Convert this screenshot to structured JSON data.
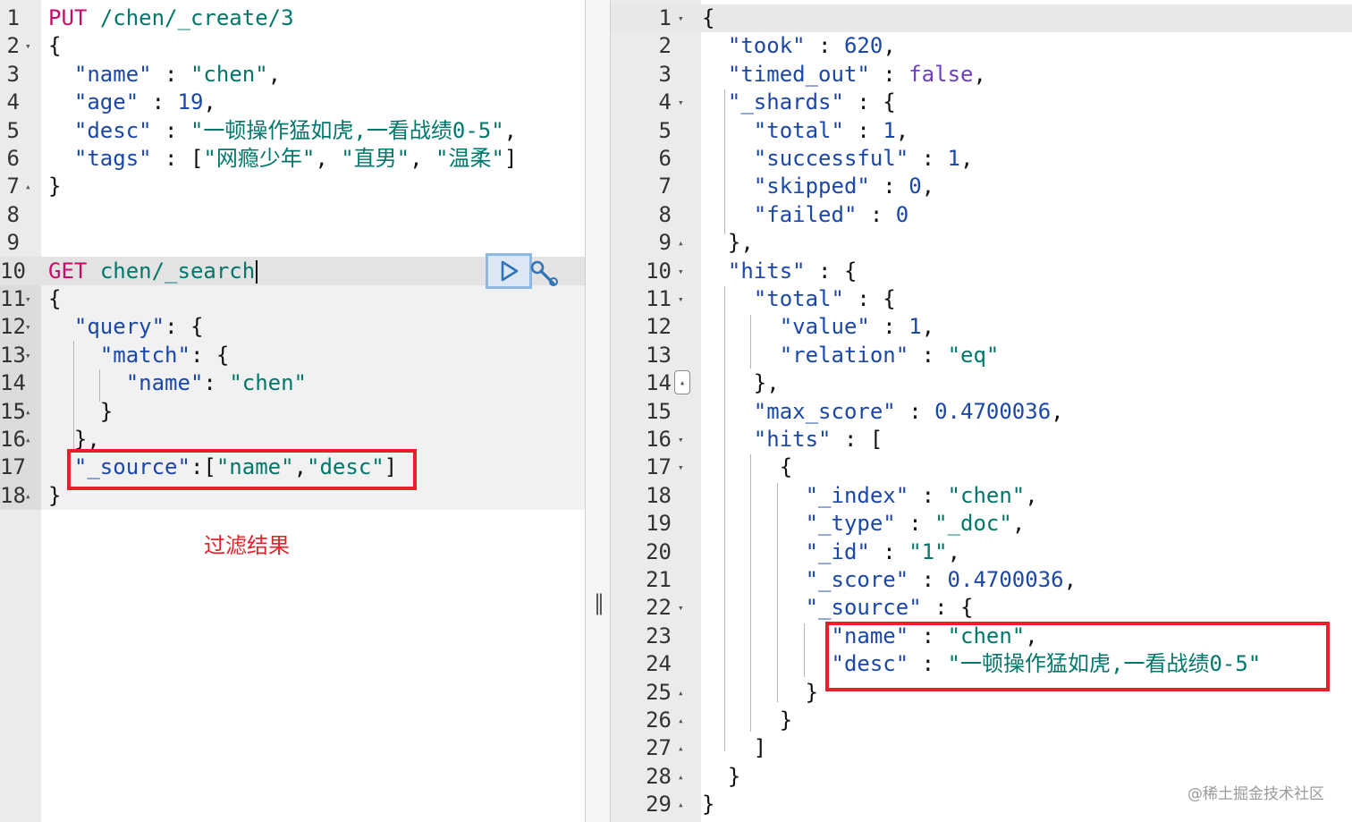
{
  "left_editor": {
    "lines": [
      {
        "ln": "1",
        "fold": "",
        "parts": [
          [
            "method",
            "PUT"
          ],
          [
            "p",
            " "
          ],
          [
            "url",
            "/chen/_create/3"
          ]
        ]
      },
      {
        "ln": "2",
        "fold": "▾",
        "parts": [
          [
            "p",
            "{"
          ]
        ]
      },
      {
        "ln": "3",
        "fold": "",
        "parts": [
          [
            "p",
            "  "
          ],
          [
            "key",
            "\"name\""
          ],
          [
            "p",
            " : "
          ],
          [
            "str",
            "\"chen\""
          ],
          [
            "p",
            ","
          ]
        ]
      },
      {
        "ln": "4",
        "fold": "",
        "parts": [
          [
            "p",
            "  "
          ],
          [
            "key",
            "\"age\""
          ],
          [
            "p",
            " : "
          ],
          [
            "num",
            "19"
          ],
          [
            "p",
            ","
          ]
        ]
      },
      {
        "ln": "5",
        "fold": "",
        "parts": [
          [
            "p",
            "  "
          ],
          [
            "key",
            "\"desc\""
          ],
          [
            "p",
            " : "
          ],
          [
            "str",
            "\"一顿操作猛如虎,一看战绩0-5\""
          ],
          [
            "p",
            ","
          ]
        ]
      },
      {
        "ln": "6",
        "fold": "",
        "parts": [
          [
            "p",
            "  "
          ],
          [
            "key",
            "\"tags\""
          ],
          [
            "p",
            " : ["
          ],
          [
            "str",
            "\"网瘾少年\""
          ],
          [
            "p",
            ", "
          ],
          [
            "str",
            "\"直男\""
          ],
          [
            "p",
            ", "
          ],
          [
            "str",
            "\"温柔\""
          ],
          [
            "p",
            "]"
          ]
        ]
      },
      {
        "ln": "7",
        "fold": "▴",
        "parts": [
          [
            "p",
            "}"
          ]
        ]
      },
      {
        "ln": "8",
        "fold": "",
        "parts": []
      },
      {
        "ln": "9",
        "fold": "",
        "parts": []
      },
      {
        "ln": "10",
        "fold": "",
        "parts": [
          [
            "method",
            "GET"
          ],
          [
            "p",
            " "
          ],
          [
            "url",
            "chen/_search"
          ]
        ]
      },
      {
        "ln": "11",
        "fold": "▾",
        "parts": [
          [
            "p",
            "{"
          ]
        ]
      },
      {
        "ln": "12",
        "fold": "▾",
        "parts": [
          [
            "p",
            "  "
          ],
          [
            "key",
            "\"query\""
          ],
          [
            "p",
            ": {"
          ]
        ]
      },
      {
        "ln": "13",
        "fold": "▾",
        "parts": [
          [
            "p",
            "    "
          ],
          [
            "key",
            "\"match\""
          ],
          [
            "p",
            ": {"
          ]
        ]
      },
      {
        "ln": "14",
        "fold": "",
        "parts": [
          [
            "p",
            "      "
          ],
          [
            "key",
            "\"name\""
          ],
          [
            "p",
            ": "
          ],
          [
            "str",
            "\"chen\""
          ]
        ]
      },
      {
        "ln": "15",
        "fold": "▴",
        "parts": [
          [
            "p",
            "    }"
          ]
        ]
      },
      {
        "ln": "16",
        "fold": "▴",
        "parts": [
          [
            "p",
            "  },"
          ]
        ]
      },
      {
        "ln": "17",
        "fold": "",
        "parts": [
          [
            "p",
            "  "
          ],
          [
            "key",
            "\"_source\""
          ],
          [
            "p",
            ":["
          ],
          [
            "str",
            "\"name\""
          ],
          [
            "p",
            ","
          ],
          [
            "str",
            "\"desc\""
          ],
          [
            "p",
            "]"
          ]
        ]
      },
      {
        "ln": "18",
        "fold": "▴",
        "parts": [
          [
            "p",
            "}"
          ]
        ]
      }
    ]
  },
  "right_editor": {
    "lines": [
      {
        "ln": "1",
        "fold": "▾",
        "parts": [
          [
            "p",
            "{"
          ]
        ]
      },
      {
        "ln": "2",
        "fold": "",
        "parts": [
          [
            "p",
            "  "
          ],
          [
            "key",
            "\"took\""
          ],
          [
            "p",
            " : "
          ],
          [
            "num",
            "620"
          ],
          [
            "p",
            ","
          ]
        ]
      },
      {
        "ln": "3",
        "fold": "",
        "parts": [
          [
            "p",
            "  "
          ],
          [
            "key",
            "\"timed_out\""
          ],
          [
            "p",
            " : "
          ],
          [
            "kw",
            "false"
          ],
          [
            "p",
            ","
          ]
        ]
      },
      {
        "ln": "4",
        "fold": "▾",
        "parts": [
          [
            "p",
            "  "
          ],
          [
            "key",
            "\"_shards\""
          ],
          [
            "p",
            " : {"
          ]
        ]
      },
      {
        "ln": "5",
        "fold": "",
        "parts": [
          [
            "p",
            "    "
          ],
          [
            "key",
            "\"total\""
          ],
          [
            "p",
            " : "
          ],
          [
            "num",
            "1"
          ],
          [
            "p",
            ","
          ]
        ]
      },
      {
        "ln": "6",
        "fold": "",
        "parts": [
          [
            "p",
            "    "
          ],
          [
            "key",
            "\"successful\""
          ],
          [
            "p",
            " : "
          ],
          [
            "num",
            "1"
          ],
          [
            "p",
            ","
          ]
        ]
      },
      {
        "ln": "7",
        "fold": "",
        "parts": [
          [
            "p",
            "    "
          ],
          [
            "key",
            "\"skipped\""
          ],
          [
            "p",
            " : "
          ],
          [
            "num",
            "0"
          ],
          [
            "p",
            ","
          ]
        ]
      },
      {
        "ln": "8",
        "fold": "",
        "parts": [
          [
            "p",
            "    "
          ],
          [
            "key",
            "\"failed\""
          ],
          [
            "p",
            " : "
          ],
          [
            "num",
            "0"
          ]
        ]
      },
      {
        "ln": "9",
        "fold": "▴",
        "parts": [
          [
            "p",
            "  },"
          ]
        ]
      },
      {
        "ln": "10",
        "fold": "▾",
        "parts": [
          [
            "p",
            "  "
          ],
          [
            "key",
            "\"hits\""
          ],
          [
            "p",
            " : {"
          ]
        ]
      },
      {
        "ln": "11",
        "fold": "▾",
        "parts": [
          [
            "p",
            "    "
          ],
          [
            "key",
            "\"total\""
          ],
          [
            "p",
            " : {"
          ]
        ]
      },
      {
        "ln": "12",
        "fold": "",
        "parts": [
          [
            "p",
            "      "
          ],
          [
            "key",
            "\"value\""
          ],
          [
            "p",
            " : "
          ],
          [
            "num",
            "1"
          ],
          [
            "p",
            ","
          ]
        ]
      },
      {
        "ln": "13",
        "fold": "",
        "parts": [
          [
            "p",
            "      "
          ],
          [
            "key",
            "\"relation\""
          ],
          [
            "p",
            " : "
          ],
          [
            "str",
            "\"eq\""
          ]
        ]
      },
      {
        "ln": "14",
        "fold": "",
        "parts": [
          [
            "p",
            "    },"
          ]
        ]
      },
      {
        "ln": "15",
        "fold": "",
        "parts": [
          [
            "p",
            "    "
          ],
          [
            "key",
            "\"max_score\""
          ],
          [
            "p",
            " : "
          ],
          [
            "num",
            "0.4700036"
          ],
          [
            "p",
            ","
          ]
        ]
      },
      {
        "ln": "16",
        "fold": "▾",
        "parts": [
          [
            "p",
            "    "
          ],
          [
            "key",
            "\"hits\""
          ],
          [
            "p",
            " : ["
          ]
        ]
      },
      {
        "ln": "17",
        "fold": "▾",
        "parts": [
          [
            "p",
            "      {"
          ]
        ]
      },
      {
        "ln": "18",
        "fold": "",
        "parts": [
          [
            "p",
            "        "
          ],
          [
            "key",
            "\"_index\""
          ],
          [
            "p",
            " : "
          ],
          [
            "str",
            "\"chen\""
          ],
          [
            "p",
            ","
          ]
        ]
      },
      {
        "ln": "19",
        "fold": "",
        "parts": [
          [
            "p",
            "        "
          ],
          [
            "key",
            "\"_type\""
          ],
          [
            "p",
            " : "
          ],
          [
            "str",
            "\"_doc\""
          ],
          [
            "p",
            ","
          ]
        ]
      },
      {
        "ln": "20",
        "fold": "",
        "parts": [
          [
            "p",
            "        "
          ],
          [
            "key",
            "\"_id\""
          ],
          [
            "p",
            " : "
          ],
          [
            "str",
            "\"1\""
          ],
          [
            "p",
            ","
          ]
        ]
      },
      {
        "ln": "21",
        "fold": "",
        "parts": [
          [
            "p",
            "        "
          ],
          [
            "key",
            "\"_score\""
          ],
          [
            "p",
            " : "
          ],
          [
            "num",
            "0.4700036"
          ],
          [
            "p",
            ","
          ]
        ]
      },
      {
        "ln": "22",
        "fold": "▾",
        "parts": [
          [
            "p",
            "        "
          ],
          [
            "key",
            "\"_source\""
          ],
          [
            "p",
            " : {"
          ]
        ]
      },
      {
        "ln": "23",
        "fold": "",
        "parts": [
          [
            "p",
            "          "
          ],
          [
            "key",
            "\"name\""
          ],
          [
            "p",
            " : "
          ],
          [
            "str",
            "\"chen\""
          ],
          [
            "p",
            ","
          ]
        ]
      },
      {
        "ln": "24",
        "fold": "",
        "parts": [
          [
            "p",
            "          "
          ],
          [
            "key",
            "\"desc\""
          ],
          [
            "p",
            " : "
          ],
          [
            "str",
            "\"一顿操作猛如虎,一看战绩0-5\""
          ]
        ]
      },
      {
        "ln": "25",
        "fold": "▴",
        "parts": [
          [
            "p",
            "        }"
          ]
        ]
      },
      {
        "ln": "26",
        "fold": "▴",
        "parts": [
          [
            "p",
            "      }"
          ]
        ]
      },
      {
        "ln": "27",
        "fold": "▴",
        "parts": [
          [
            "p",
            "    ]"
          ]
        ]
      },
      {
        "ln": "28",
        "fold": "▴",
        "parts": [
          [
            "p",
            "  }"
          ]
        ]
      },
      {
        "ln": "29",
        "fold": "▴",
        "parts": [
          [
            "p",
            "}"
          ]
        ]
      }
    ]
  },
  "annotation_text": "过滤结果",
  "watermark_text": "@稀土掘金技术社区",
  "icons": {
    "run": "play-icon",
    "settings": "wrench-icon",
    "divider": "resize-grip-icon",
    "fold_open": "fold-open-icon",
    "fold_close": "fold-close-icon"
  },
  "colors": {
    "method": "#c80a68",
    "string": "#00776a",
    "key": "#1a47a8",
    "highlight_box": "#e8202a"
  }
}
